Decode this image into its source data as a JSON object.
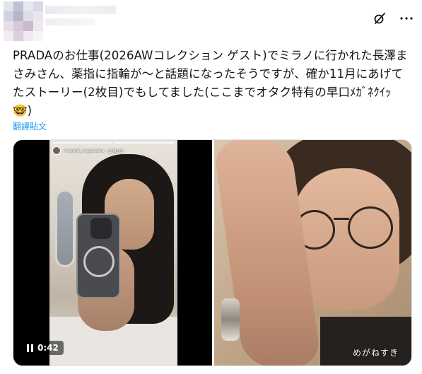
{
  "tweet": {
    "text": "PRADAのお仕事(2026AWコレクション ゲスト)でミラノに行かれた長澤まさみさん、薬指に指輪が〜と話題になったそうですが、確か11月にあげてたストーリー(2枚目)でもしてました(ここまでオタク特有の早口ﾒｶﾞﾈｸｲｯ",
    "emoji": "🤓",
    "closing": ")",
    "translate_label": "翻譯貼文"
  },
  "header": {
    "icons": [
      "grok-icon",
      "more-icon"
    ]
  },
  "media": {
    "video": {
      "story_user": "masami_nagasawa",
      "story_time": "12月6日",
      "duration": "0:42"
    },
    "image": {
      "caption": "めがねすき"
    }
  },
  "colors": {
    "link": "#1d9bf0",
    "text": "#0f1419"
  }
}
